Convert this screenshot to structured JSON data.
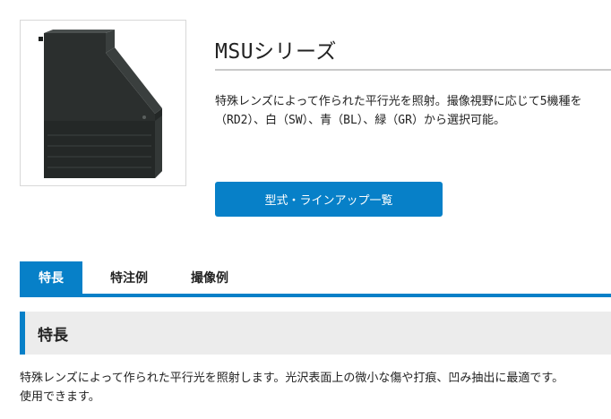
{
  "product": {
    "title": "MSUシリーズ",
    "description_lines": [
      "特殊レンズによって作られた平行光を照射。撮像視野に応じて5機種を",
      "（RD2）、白（SW）、青（BL）、緑（GR）から選択可能。"
    ],
    "lineup_button": "型式・ラインアップ一覧"
  },
  "tabs": [
    {
      "label": "特長",
      "active": true
    },
    {
      "label": "特注例",
      "active": false
    },
    {
      "label": "撮像例",
      "active": false
    }
  ],
  "section": {
    "heading": "特長",
    "body_lines": [
      "特殊レンズによって作られた平行光を照射します。光沢表面上の微小な傷や打痕、凹み抽出に最適です。",
      "使用できます。"
    ]
  },
  "colors": {
    "accent": "#0780c8",
    "section_bg": "#ececec",
    "rule": "#c9c9c9",
    "product_body": "#2b2f2e"
  }
}
